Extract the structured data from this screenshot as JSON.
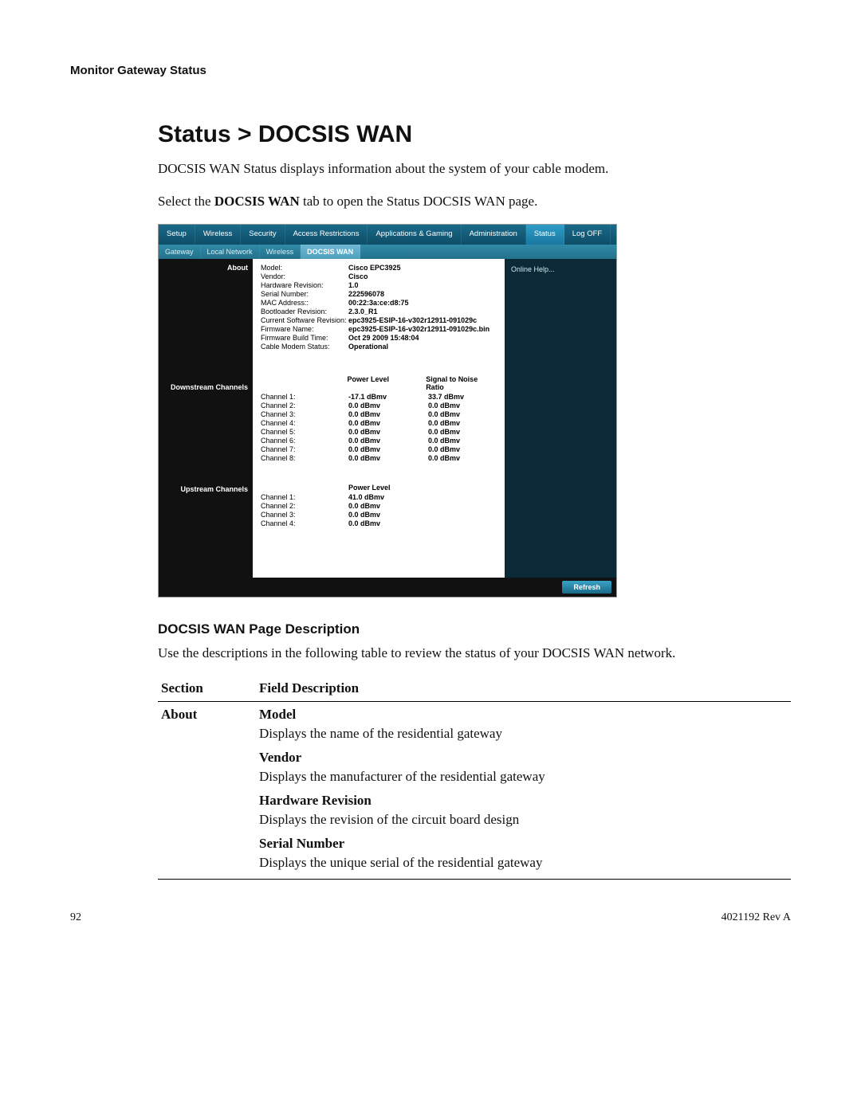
{
  "header": "Monitor Gateway Status",
  "title": "Status > DOCSIS WAN",
  "intro1": "DOCSIS WAN Status displays information about the system of your cable modem.",
  "intro2a": "Select the ",
  "intro2b": "DOCSIS WAN",
  "intro2c": " tab to open the Status DOCSIS WAN page.",
  "nav1": {
    "setup": "Setup",
    "wireless": "Wireless",
    "security": "Security",
    "access": "Access Restrictions",
    "apps": "Applications & Gaming",
    "admin": "Administration",
    "status": "Status",
    "logoff": "Log OFF"
  },
  "nav2": {
    "gateway": "Gateway",
    "local": "Local Network",
    "wireless": "Wireless",
    "docsis": "DOCSIS WAN"
  },
  "left": {
    "about": "About",
    "down": "Downstream Channels",
    "up": "Upstream Channels"
  },
  "about_kv": {
    "l0": "Model:",
    "v0": "Cisco EPC3925",
    "l1": "Vendor:",
    "v1": "Cisco",
    "l2": "Hardware Revision:",
    "v2": "1.0",
    "l3": "Serial Number:",
    "v3": "222596078",
    "l4": "MAC Address::",
    "v4": "00:22:3a:ce:d8:75",
    "l5": "Bootloader Revision:",
    "v5": "2.3.0_R1",
    "l6": "Current Software Revision:",
    "v6": "epc3925-ESIP-16-v302r12911-091029c",
    "l7": "Firmware Name:",
    "v7": "epc3925-ESIP-16-v302r12911-091029c.bin",
    "l8": "Firmware Build Time:",
    "v8": "Oct 29 2009 15:48:04",
    "l9": "Cable Modem Status:",
    "v9": "Operational"
  },
  "down_head": {
    "c2": "Power Level",
    "c3": "Signal to Noise Ratio"
  },
  "down": {
    "r0c1": "Channel 1:",
    "r0c2": "-17.1 dBmv",
    "r0c3": "33.7 dBmv",
    "r1c1": "Channel 2:",
    "r1c2": "0.0 dBmv",
    "r1c3": "0.0 dBmv",
    "r2c1": "Channel 3:",
    "r2c2": "0.0 dBmv",
    "r2c3": "0.0 dBmv",
    "r3c1": "Channel 4:",
    "r3c2": "0.0 dBmv",
    "r3c3": "0.0 dBmv",
    "r4c1": "Channel 5:",
    "r4c2": "0.0 dBmv",
    "r4c3": "0.0 dBmv",
    "r5c1": "Channel 6:",
    "r5c2": "0.0 dBmv",
    "r5c3": "0.0 dBmv",
    "r6c1": "Channel 7:",
    "r6c2": "0.0 dBmv",
    "r6c3": "0.0 dBmv",
    "r7c1": "Channel 8:",
    "r7c2": "0.0 dBmv",
    "r7c3": "0.0 dBmv"
  },
  "up_head": {
    "c2": "Power Level"
  },
  "up": {
    "r0c1": "Channel 1:",
    "r0c2": "41.0 dBmv",
    "r1c1": "Channel 2:",
    "r1c2": "0.0 dBmv",
    "r2c1": "Channel 3:",
    "r2c2": "0.0 dBmv",
    "r3c1": "Channel 4:",
    "r3c2": "0.0 dBmv"
  },
  "right": {
    "help": "Online Help..."
  },
  "refresh": "Refresh",
  "desc_heading": "DOCSIS WAN Page Description",
  "desc_intro": "Use the descriptions in the following table to review the status of your DOCSIS WAN network.",
  "table": {
    "h1": "Section",
    "h2": "Field Description",
    "section": "About",
    "f0n": "Model",
    "f0d": "Displays the name of the residential gateway",
    "f1n": "Vendor",
    "f1d": "Displays the manufacturer of the residential gateway",
    "f2n": "Hardware Revision",
    "f2d": "Displays the revision of the circuit board design",
    "f3n": "Serial Number",
    "f3d": "Displays the unique serial of the residential gateway"
  },
  "footer": {
    "page": "92",
    "doc": "4021192 Rev A"
  }
}
